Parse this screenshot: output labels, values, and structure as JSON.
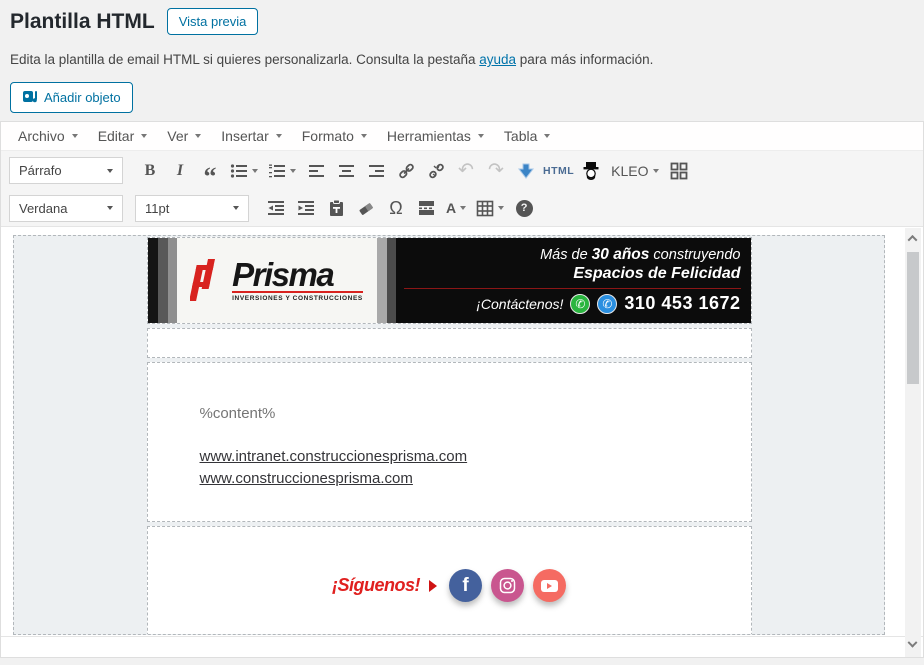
{
  "page": {
    "title": "Plantilla HTML",
    "preview_button": "Vista previa",
    "desc_before": "Edita la plantilla de email HTML si quieres personalizarla. Consulta la pestaña ",
    "desc_link": "ayuda",
    "desc_after": " para más información.",
    "add_media": "Añadir objeto"
  },
  "menu": {
    "archivo": "Archivo",
    "editar": "Editar",
    "ver": "Ver",
    "insertar": "Insertar",
    "formato": "Formato",
    "herramientas": "Herramientas",
    "tabla": "Tabla"
  },
  "toolbar": {
    "block_format": "Párrafo",
    "bold": "B",
    "italic": "I",
    "blockquote": "“",
    "html": "HTML",
    "kleo": "KLEO",
    "font_family": "Verdana",
    "font_size": "11pt",
    "undo_glyph": "↶",
    "redo_glyph": "↷",
    "omega": "Ω",
    "text_color": "A",
    "help": "?"
  },
  "email": {
    "logo": {
      "brand": "Prisma",
      "tagline": "INVERSIONES Y CONSTRUCCIONES"
    },
    "banner": {
      "line1_pre": "Más de ",
      "line1_bold": "30 años",
      "line1_post": " construyendo",
      "line2": "Espacios de Felicidad",
      "contact": "¡Contáctenos!",
      "phone": "310 453 1672",
      "phone_glyph": "✆"
    },
    "content_placeholder": "%content%",
    "link1": "www.intranet.construccionesprisma.com",
    "link2": "www.construccionesprisma.com",
    "follow": "¡Síguenos!",
    "facebook_glyph": "f"
  },
  "colors": {
    "accent_blue": "#0071a1",
    "link_blue": "#0073aa",
    "whatsapp_green": "#2ab53f",
    "phone_blue": "#2a8fe0",
    "facebook": "#44619d",
    "instagram": "#c9568f",
    "youtube": "#f56b62",
    "banner_red": "#8b1616",
    "follow_red": "#e0201f"
  }
}
